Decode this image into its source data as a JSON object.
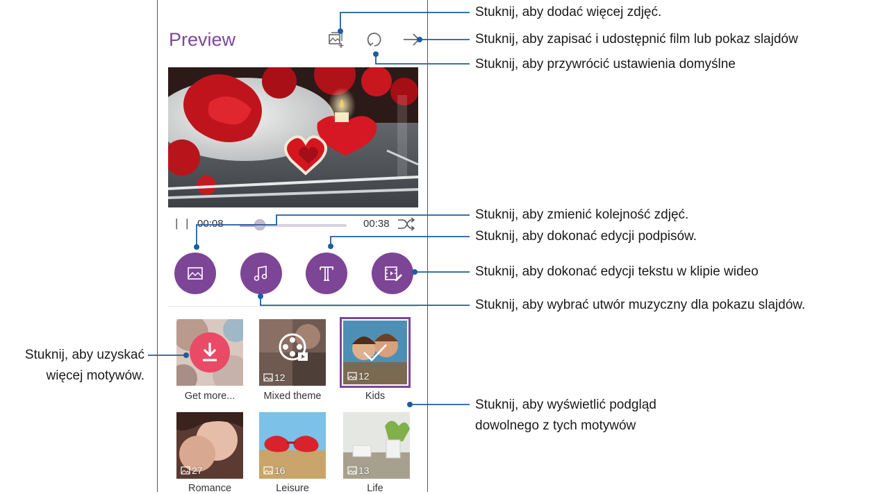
{
  "screen": {
    "title": "Preview",
    "player": {
      "pause_symbol": "| |",
      "current_time": "00:08",
      "total_time": "00:38",
      "progress": 0.19
    },
    "themes": [
      {
        "label": "Get more...",
        "count": ""
      },
      {
        "label": "Mixed theme",
        "count": "12"
      },
      {
        "label": "Kids",
        "count": "12",
        "selected": true
      },
      {
        "label": "Romance",
        "count": "27"
      },
      {
        "label": "Leisure",
        "count": "16"
      },
      {
        "label": "Life",
        "count": "13"
      }
    ],
    "accent_color": "#7d4595"
  },
  "callouts": {
    "add_photos": "Stuknij, aby dodać więcej zdjęć.",
    "save_share": "Stuknij, aby zapisać i udostępnić film lub pokaz slajdów",
    "reset": "Stuknij, aby przywrócić ustawienia domyślne",
    "reorder": "Stuknij, aby zmienić kolejność zdjęć.",
    "captions": "Stuknij, aby dokonać edycji podpisów.",
    "video_text": "Stuknij, aby dokonać edycji tekstu w klipie wideo",
    "music": "Stuknij, aby wybrać utwór muzyczny dla pokazu slajdów.",
    "more_themes_line1": "Stuknij, aby uzyskać",
    "more_themes_line2": "więcej motywów.",
    "preview_themes_line1": "Stuknij, aby wyświetlić podgląd",
    "preview_themes_line2": "dowolnego z tych motywów"
  },
  "icons": [
    "add-photo-icon",
    "reset-icon",
    "arrow-right-icon",
    "shuffle-icon",
    "image-icon",
    "music-note-icon",
    "text-icon",
    "video-edit-icon",
    "download-icon",
    "film-reel-icon",
    "check-icon"
  ]
}
